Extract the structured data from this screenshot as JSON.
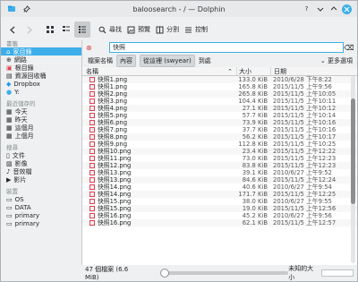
{
  "window": {
    "title": "baloosearch - / — Dolphin",
    "icons": [
      "dolphin-icon",
      "pin-icon",
      "help-icon",
      "minimize-icon",
      "maximize-icon",
      "close-icon"
    ]
  },
  "toolbar": {
    "search_label": "尋找",
    "preview_label": "預覽",
    "split_label": "分割",
    "control_label": "控制"
  },
  "sidebar": {
    "places_heading": "書籤",
    "places": [
      {
        "label": "家目錄",
        "icon": "home-icon",
        "selected": true
      },
      {
        "label": "網路",
        "icon": "network-icon"
      },
      {
        "label": "根目錄",
        "icon": "root-folder-icon"
      },
      {
        "label": "資源回收桶",
        "icon": "trash-icon"
      },
      {
        "label": "Dropbox",
        "icon": "dropbox-icon"
      },
      {
        "label": "Y:",
        "icon": "drive-icon"
      }
    ],
    "recent_heading": "最近儲存的",
    "recent": [
      {
        "label": "今天",
        "icon": "calendar-icon"
      },
      {
        "label": "昨天",
        "icon": "calendar-icon"
      },
      {
        "label": "這個月",
        "icon": "calendar-icon"
      },
      {
        "label": "上個月",
        "icon": "calendar-icon"
      }
    ],
    "search_heading": "搜尋",
    "search": [
      {
        "label": "文件",
        "icon": "document-icon"
      },
      {
        "label": "影像",
        "icon": "image-icon"
      },
      {
        "label": "音效檔",
        "icon": "audio-icon"
      },
      {
        "label": "影片",
        "icon": "video-icon"
      }
    ],
    "devices_heading": "裝置",
    "devices": [
      {
        "label": "OS",
        "icon": "disk-icon"
      },
      {
        "label": "DATA",
        "icon": "disk-icon"
      },
      {
        "label": "primary",
        "icon": "disk-icon"
      },
      {
        "label": "primary",
        "icon": "disk-icon"
      }
    ]
  },
  "search": {
    "query": "快照",
    "filter_name": "檔案名稱",
    "filter_content": "內容",
    "filter_from": "從這裡 (swyear)",
    "filter_everywhere": "到處",
    "more_options": "更多選項"
  },
  "list": {
    "headers": {
      "name": "名稱",
      "size": "大小",
      "date": "日期"
    },
    "rows": [
      {
        "name": "快照1.png",
        "size": "133.0 KiB",
        "date": "2010/6/28 下午8:22"
      },
      {
        "name": "快照1.png",
        "size": "165.8 KiB",
        "date": "2015/11/5 上午9:56"
      },
      {
        "name": "快照2.png",
        "size": "265.8 KiB",
        "date": "2015/11/5 上午10:05"
      },
      {
        "name": "快照3.png",
        "size": "104.4 KiB",
        "date": "2015/11/5 上午10:11"
      },
      {
        "name": "快照4.png",
        "size": "27.1 KiB",
        "date": "2015/11/5 上午10:12"
      },
      {
        "name": "快照5.png",
        "size": "57.7 KiB",
        "date": "2015/11/5 上午10:14"
      },
      {
        "name": "快照6.png",
        "size": "73.9 KiB",
        "date": "2015/11/5 上午10:16"
      },
      {
        "name": "快照7.png",
        "size": "37.7 KiB",
        "date": "2015/11/5 上午10:16"
      },
      {
        "name": "快照8.png",
        "size": "56.2 KiB",
        "date": "2015/11/5 上午10:17"
      },
      {
        "name": "快照9.png",
        "size": "112.8 KiB",
        "date": "2015/11/5 上午10:25"
      },
      {
        "name": "快照10.png",
        "size": "23.4 KiB",
        "date": "2015/11/5 上午12:22"
      },
      {
        "name": "快照11.png",
        "size": "73.0 KiB",
        "date": "2015/11/5 上午12:23"
      },
      {
        "name": "快照12.png",
        "size": "83.8 KiB",
        "date": "2015/11/5 上午12:23"
      },
      {
        "name": "快照13.png",
        "size": "39.1 KiB",
        "date": "2010/6/27 上午9:52"
      },
      {
        "name": "快照13.png",
        "size": "84.6 KiB",
        "date": "2015/11/5 上午12:24"
      },
      {
        "name": "快照14.png",
        "size": "40.6 KiB",
        "date": "2010/6/27 上午9:54"
      },
      {
        "name": "快照14.png",
        "size": "171.7 KiB",
        "date": "2015/11/5 上午12:25"
      },
      {
        "name": "快照15.png",
        "size": "38.0 KiB",
        "date": "2010/6/27 上午9:55"
      },
      {
        "name": "快照15.png",
        "size": "19.0 KiB",
        "date": "2015/11/5 上午12:56"
      },
      {
        "name": "快照16.png",
        "size": "45.2 KiB",
        "date": "2010/6/27 上午9:56"
      },
      {
        "name": "快照16.png",
        "size": "62.1 KiB",
        "date": "2015/11/5 上午12:57"
      }
    ]
  },
  "status": {
    "summary": "47 個檔案 (6.6 MiB)",
    "free_space": "未知的大小"
  },
  "colors": {
    "accent": "#3daee9",
    "close": "#da4453"
  }
}
